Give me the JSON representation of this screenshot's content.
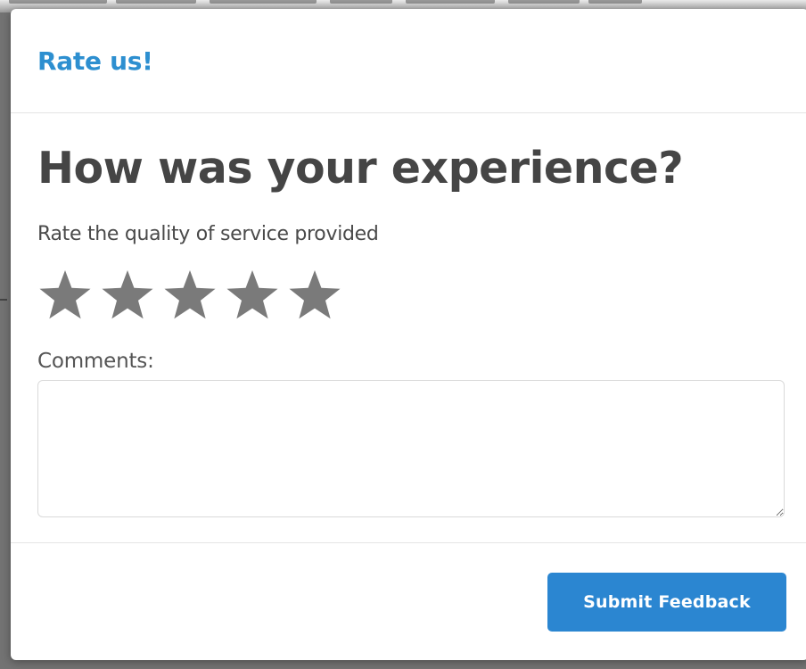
{
  "modal": {
    "title": "Rate us!",
    "question": "How was your experience?",
    "subtitle": "Rate the quality of service provided",
    "rating": {
      "max": 5,
      "selected": 0,
      "star_color": "#7a7a7a"
    },
    "comments": {
      "label": "Comments:",
      "value": "",
      "placeholder": ""
    },
    "submit_label": "Submit Feedback"
  },
  "colors": {
    "accent": "#2d8fd0",
    "button": "#2b86d1",
    "heading": "#454545",
    "backdrop": "#737373"
  },
  "icons": {
    "star": "star-icon",
    "resize": "resize-handle-icon"
  }
}
